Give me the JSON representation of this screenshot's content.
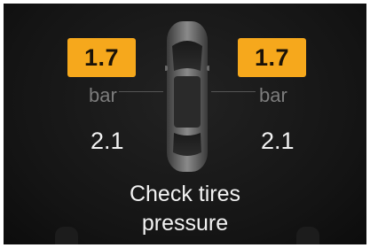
{
  "tires": {
    "front_left": "1.7",
    "front_right": "1.7",
    "rear_left": "2.1",
    "rear_right": "2.1",
    "unit": "bar"
  },
  "message": {
    "line1": "Check tires",
    "line2": "pressure"
  },
  "colors": {
    "warning": "#f6a81c",
    "background": "#141414",
    "text": "#f2f2f2",
    "unit_text": "#7c7c7c"
  },
  "icons": {
    "vehicle": "car-top-view-icon"
  }
}
